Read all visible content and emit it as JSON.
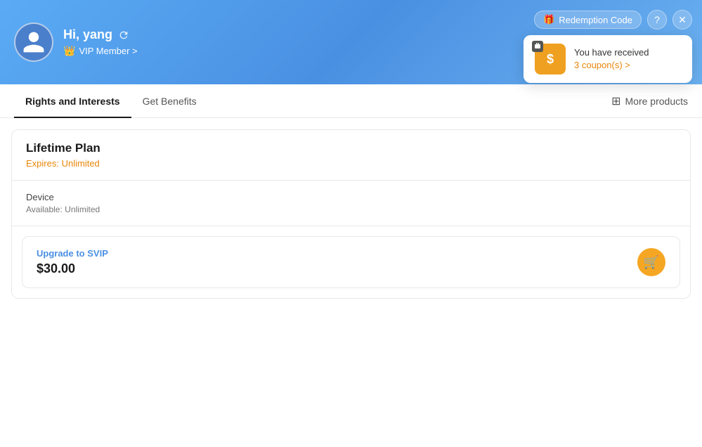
{
  "header": {
    "greeting": "Hi, yang",
    "vip_label": "VIP Member >",
    "redemption_btn": "Redemption Code",
    "coupon_text": "You have received",
    "coupon_count": "3 coupon(s) >"
  },
  "tabs": {
    "tab1": "Rights and Interests",
    "tab2": "Get Benefits",
    "more_products": "More products"
  },
  "plan": {
    "name": "Lifetime Plan",
    "expires_label": "Expires:",
    "expires_value": "Unlimited",
    "device_label": "Device",
    "available_label": "Available: Unlimited",
    "upgrade_label": "Upgrade to",
    "upgrade_plan": "SVIP",
    "upgrade_price": "$30.00"
  }
}
